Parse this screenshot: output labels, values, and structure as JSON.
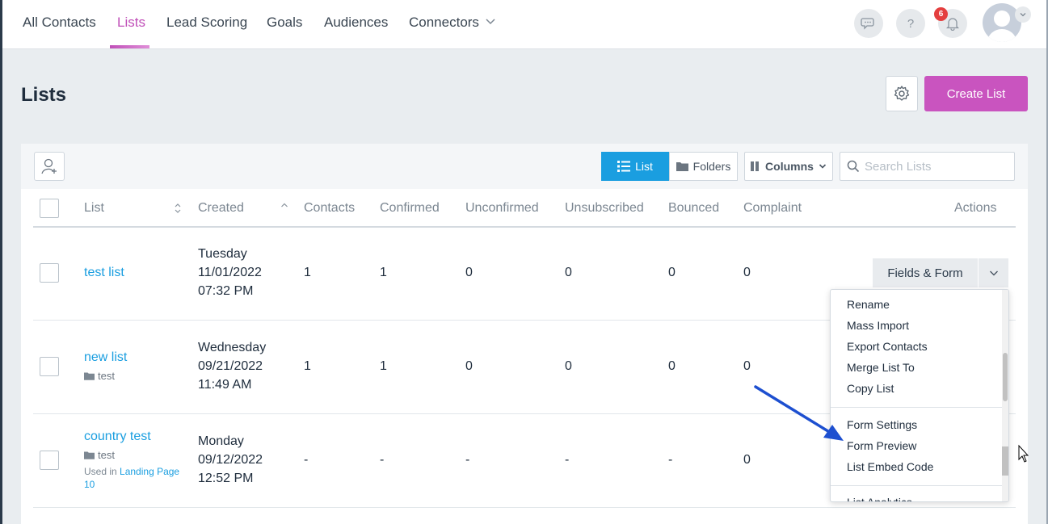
{
  "nav": {
    "items": [
      "All Contacts",
      "Lists",
      "Lead Scoring",
      "Goals",
      "Audiences",
      "Connectors"
    ],
    "notification_count": "6"
  },
  "header": {
    "title": "Lists",
    "create_label": "Create List"
  },
  "toolbar": {
    "list_label": "List",
    "folders_label": "Folders",
    "columns_label": "Columns",
    "search_placeholder": "Search Lists"
  },
  "table": {
    "columns": [
      "List",
      "Created",
      "Contacts",
      "Confirmed",
      "Unconfirmed",
      "Unsubscribed",
      "Bounced",
      "Complaint",
      "Actions"
    ],
    "rows": [
      {
        "name": "test list",
        "day": "Tuesday",
        "date": "11/01/2022",
        "time": "07:32 PM",
        "contacts": "1",
        "confirmed": "1",
        "unconfirmed": "0",
        "unsubscribed": "0",
        "bounced": "0",
        "complaint": "0"
      },
      {
        "name": "new list",
        "folder": "test",
        "day": "Wednesday",
        "date": "09/21/2022",
        "time": "11:49 AM",
        "contacts": "1",
        "confirmed": "1",
        "unconfirmed": "0",
        "unsubscribed": "0",
        "bounced": "0",
        "complaint": "0"
      },
      {
        "name": "country test",
        "folder": "test",
        "used_in_prefix": "Used in",
        "used_in_link": "Landing Page 10",
        "day": "Monday",
        "date": "09/12/2022",
        "time": "12:52 PM",
        "contacts": "-",
        "confirmed": "-",
        "unconfirmed": "-",
        "unsubscribed": "-",
        "bounced": "-",
        "complaint": "0"
      }
    ],
    "action_label": "Fields & Form"
  },
  "dropdown": {
    "group1": [
      "Rename",
      "Mass Import",
      "Export Contacts",
      "Merge List To",
      "Copy List"
    ],
    "group2": [
      "Form Settings",
      "Form Preview",
      "List Embed Code"
    ],
    "group3": [
      "List Analytics"
    ]
  },
  "colors": {
    "accent": "#c954bf",
    "link": "#1a9ee0",
    "arrow": "#1d4fd0"
  }
}
